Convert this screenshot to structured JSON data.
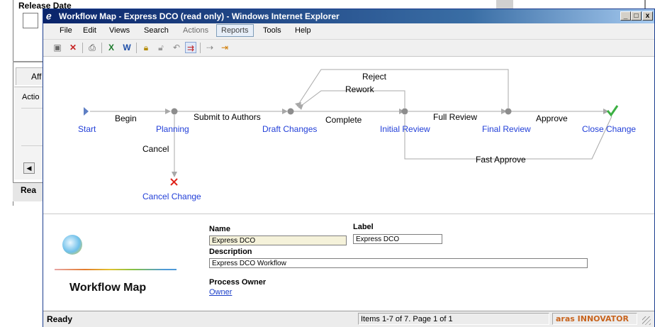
{
  "background_window": {
    "release_date_label": "Release Date",
    "tab_label": "Aff",
    "action_label": "Actio",
    "status_label": "Rea"
  },
  "window": {
    "title": "Workflow Map - Express DCO (read only) - Windows Internet Explorer",
    "controls": {
      "minimize": "_",
      "maximize": "□",
      "close": "x"
    }
  },
  "menu": {
    "file": "File",
    "edit": "Edit",
    "views": "Views",
    "search": "Search",
    "actions": "Actions",
    "reports": "Reports",
    "tools": "Tools",
    "help": "Help"
  },
  "toolbar": {
    "icons": [
      "save-icon",
      "close-doc-icon",
      "print-icon",
      "excel-export-icon",
      "word-export-icon",
      "lock-icon",
      "unlock-icon",
      "undo-icon",
      "show-map-icon",
      "promote-icon",
      "exit-icon"
    ]
  },
  "workflow": {
    "nodes": {
      "start": "Start",
      "planning": "Planning",
      "draft_changes": "Draft Changes",
      "initial_review": "Initial Review",
      "final_review": "Final Review",
      "close_change": "Close Change",
      "cancel_change": "Cancel Change"
    },
    "paths": {
      "begin": "Begin",
      "submit_to_authors": "Submit to Authors",
      "complete": "Complete",
      "full_review": "Full Review",
      "approve": "Approve",
      "reject": "Reject",
      "rework": "Rework",
      "fast_approve": "Fast Approve",
      "cancel": "Cancel"
    },
    "colors": {
      "node_label": "#2340d8",
      "connector": "#a8a8a8",
      "check": "#3cb043",
      "cancel_x": "#e0241b"
    }
  },
  "form": {
    "panel_title": "Workflow Map",
    "name_label": "Name",
    "name_value": "Express DCO",
    "label_label": "Label",
    "label_value": "Express DCO",
    "description_label": "Description",
    "description_value": "Express DCO Workflow",
    "process_owner_label": "Process Owner",
    "owner_link": "Owner"
  },
  "status": {
    "ready": "Ready",
    "items": "Items 1-7 of 7. Page 1 of 1",
    "logo": "aras INNOVATOR"
  }
}
